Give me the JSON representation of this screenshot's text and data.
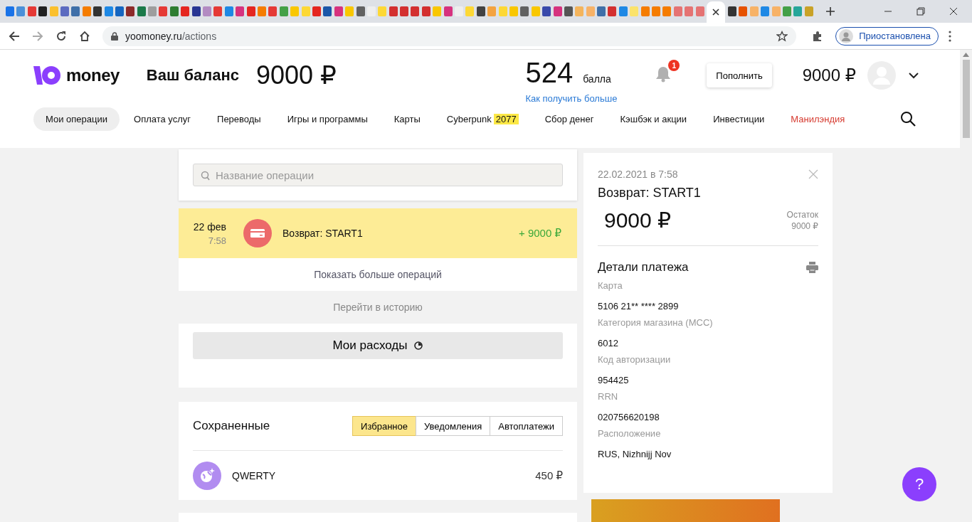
{
  "browser": {
    "tabs": [
      {
        "color": "#1a73e8",
        "selected": false
      },
      {
        "color": "#4a90d9",
        "selected": false
      },
      {
        "color": "#e53935",
        "selected": false
      },
      {
        "color": "#212121",
        "selected": false
      },
      {
        "color": "#fbc02d",
        "selected": false
      },
      {
        "color": "#5c6bc0",
        "selected": false
      },
      {
        "color": "#3f6fa8",
        "selected": false
      },
      {
        "color": "#f57c00",
        "selected": false
      },
      {
        "color": "#333333",
        "selected": false
      },
      {
        "color": "#1e88e5",
        "selected": false
      },
      {
        "color": "#1565c0",
        "selected": false
      },
      {
        "color": "#8d2a2a",
        "selected": false
      },
      {
        "color": "#1b7a4a",
        "selected": false
      },
      {
        "color": "#9e9e9e",
        "selected": false
      },
      {
        "color": "#e53935",
        "selected": false
      },
      {
        "color": "#2e7d32",
        "selected": false
      },
      {
        "color": "#e52620",
        "selected": false
      },
      {
        "color": "#283593",
        "selected": false
      },
      {
        "color": "#b38bc2",
        "selected": false
      },
      {
        "color": "#e53935",
        "selected": false
      },
      {
        "color": "#1e88e5",
        "selected": false
      },
      {
        "color": "#d6327e",
        "selected": false
      },
      {
        "color": "#e52620",
        "selected": false
      },
      {
        "color": "#f57c00",
        "selected": false
      },
      {
        "color": "#e53935",
        "selected": false
      },
      {
        "color": "#43a047",
        "selected": false
      },
      {
        "color": "#f9c700",
        "selected": false
      },
      {
        "color": "#fdd835",
        "selected": false
      },
      {
        "color": "#e52620",
        "selected": false
      },
      {
        "color": "#1a56a8",
        "selected": false
      },
      {
        "color": "#d6327e",
        "selected": false
      },
      {
        "color": "#f9c700",
        "selected": false
      },
      {
        "color": "#616161",
        "selected": false
      },
      {
        "color": "#eeeeee",
        "selected": false
      },
      {
        "color": "#fdd835",
        "selected": false
      },
      {
        "color": "#d32f2f",
        "selected": false
      },
      {
        "color": "#d32f2f",
        "selected": false
      },
      {
        "color": "#d32f2f",
        "selected": false
      },
      {
        "color": "#d32f2f",
        "selected": false
      },
      {
        "color": "#f9c700",
        "selected": false
      },
      {
        "color": "#d6327e",
        "selected": false
      },
      {
        "color": "#eeeeee",
        "selected": false
      },
      {
        "color": "#fdd835",
        "selected": false
      },
      {
        "color": "#424242",
        "selected": false
      },
      {
        "color": "#f4a340",
        "selected": false
      },
      {
        "color": "#fdd835",
        "selected": false
      },
      {
        "color": "#f9c700",
        "selected": false
      },
      {
        "color": "#616161",
        "selected": false
      },
      {
        "color": "#f9c700",
        "selected": false
      },
      {
        "color": "#3949ab",
        "selected": false
      },
      {
        "color": "#d6327e",
        "selected": false
      },
      {
        "color": "#555555",
        "selected": false
      },
      {
        "color": "#f4b45c",
        "selected": false
      },
      {
        "color": "#f7b267",
        "selected": false
      },
      {
        "color": "#3f6fa8",
        "selected": false
      },
      {
        "color": "#d32f2f",
        "selected": false
      },
      {
        "color": "#1e88e5",
        "selected": false
      },
      {
        "color": "#fbe36b",
        "selected": false
      },
      {
        "color": "#f57c00",
        "selected": false
      },
      {
        "color": "#f57c00",
        "selected": false
      },
      {
        "color": "#f57c00",
        "selected": false
      },
      {
        "color": "#e57373",
        "selected": false
      },
      {
        "color": "#e57373",
        "selected": false
      },
      {
        "color": "#e57373",
        "selected": false
      },
      {
        "selected": true
      },
      {
        "color": "#333333",
        "selected": false
      },
      {
        "color": "#e65100",
        "selected": false
      },
      {
        "color": "#f7b267",
        "selected": false
      },
      {
        "color": "#1e88e5",
        "selected": false
      },
      {
        "color": "#f7b267",
        "selected": false
      },
      {
        "color": "#43a047",
        "selected": false
      },
      {
        "color": "#26a69a",
        "selected": false
      },
      {
        "color": "#c9a227",
        "selected": false
      }
    ],
    "url_host": "yoomoney.ru",
    "url_path": "/actions",
    "profile": "Приостановлена"
  },
  "header": {
    "logo": "money",
    "balance_label": "Ваш баланс",
    "balance": "9000 ₽",
    "points": "524",
    "points_unit": "балла",
    "points_link": "Как получить больше",
    "notifications": "1",
    "topup_button": "Пополнить",
    "wallet": "9000 ₽"
  },
  "nav": [
    {
      "label": "Мои операции",
      "selected": true
    },
    {
      "label": "Оплата услуг",
      "selected": false
    },
    {
      "label": "Переводы",
      "selected": false
    },
    {
      "label": "Игры и программы",
      "selected": false
    },
    {
      "label": "Карты",
      "selected": false
    },
    {
      "label": "Cyberpunk",
      "badge": "2077",
      "selected": false
    },
    {
      "label": "Сбор денег",
      "selected": false
    },
    {
      "label": "Кэшбэк и акции",
      "selected": false
    },
    {
      "label": "Инвестиции",
      "selected": false
    },
    {
      "label": "Манилэндия",
      "kind": "promo",
      "selected": false
    }
  ],
  "search": {
    "placeholder": "Название операции"
  },
  "operations": [
    {
      "date": "22 фев",
      "time": "7:58",
      "title": "Возврат: START1",
      "amount": "+ 9000 ₽",
      "selected": true
    }
  ],
  "show_more": "Показать больше операций",
  "history_link": "Перейти в историю",
  "expenses_button": "Мои расходы",
  "saved": {
    "title": "Сохраненные",
    "tabs": [
      {
        "label": "Избранное",
        "selected": true
      },
      {
        "label": "Уведомления",
        "selected": false
      },
      {
        "label": "Автоплатежи",
        "selected": false
      }
    ],
    "items": [
      {
        "name": "QWERTY",
        "amount": "450 ₽"
      }
    ]
  },
  "detail": {
    "datetime": "22.02.2021 в 7:58",
    "title": "Возврат: START1",
    "amount": "9000 ₽",
    "balance_label": "Остаток",
    "balance": "9000 ₽",
    "section_title": "Детали платежа",
    "fields": [
      {
        "label": "Карта",
        "value": "5106 21** **** 2899"
      },
      {
        "label": "Категория магазина (MCC)",
        "value": "6012"
      },
      {
        "label": "Код авторизации",
        "value": "954425"
      },
      {
        "label": "RRN",
        "value": "020756620198"
      },
      {
        "label": "Расположение",
        "value": "RUS, Nizhnijj Nov"
      }
    ]
  },
  "help_button": "?"
}
